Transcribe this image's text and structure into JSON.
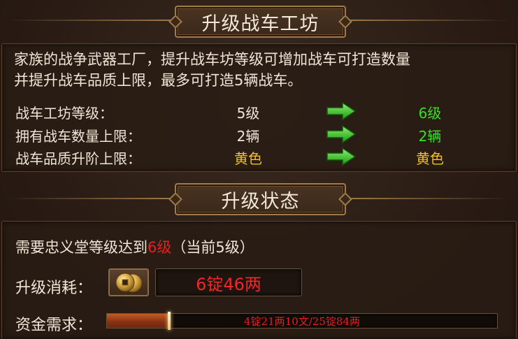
{
  "section1": {
    "title": "升级战车工坊",
    "description_line1": "家族的战争武器工厂，提升战车坊等级可增加战车可打造数量",
    "description_line2": "并提升战车品质上限，最多可打造5辆战车。",
    "stats": [
      {
        "label": "战车工坊等级：",
        "current": "5级",
        "next": "6级"
      },
      {
        "label": "拥有战车数量上限：",
        "current": "2辆",
        "next": "2辆"
      },
      {
        "label": "战车品质升阶上限：",
        "current": "黄色",
        "next": "黄色"
      }
    ]
  },
  "section2": {
    "title": "升级状态",
    "requirement_prefix": "需要忠义堂等级达到",
    "requirement_level": "6级",
    "requirement_suffix": "（当前5级）",
    "cost_label": "升级消耗：",
    "cost_value": "6锭46两",
    "fund_label": "资金需求：",
    "fund_progress_text": "4锭21两10文/25锭84两",
    "fund_progress_fraction": 0.16
  },
  "icons": {
    "arrow": "green-right-arrow-icon",
    "coin": "copper-coin-icon"
  },
  "colors": {
    "next_value_green": "#38e020",
    "quality_yellow": "#f2c020",
    "warning_red": "#e82020"
  }
}
